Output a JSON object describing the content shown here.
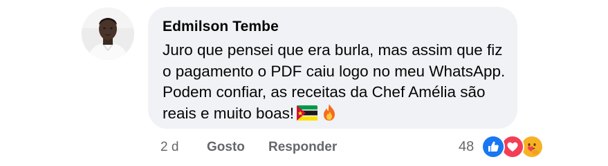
{
  "comment": {
    "author": "Edmilson Tembe",
    "text": "Juro que pensei que era burla, mas assim que fiz o pagamento o PDF caiu logo no meu WhatsApp. Podem confiar, as receitas da Chef Amélia são reais e muito boas!",
    "emojis": [
      "mozambique-flag",
      "fire"
    ]
  },
  "actions": {
    "time": "2 d",
    "like_label": "Gosto",
    "reply_label": "Responder"
  },
  "reactions": {
    "count": "48",
    "types": [
      "like-icon",
      "love-icon",
      "care-icon"
    ],
    "colors": {
      "like": "#1877f2",
      "love": "#f33e58",
      "care": "#f7b125"
    }
  },
  "colors": {
    "bubble": "#f0f2f5",
    "text": "#050505",
    "secondary": "#65676b"
  }
}
